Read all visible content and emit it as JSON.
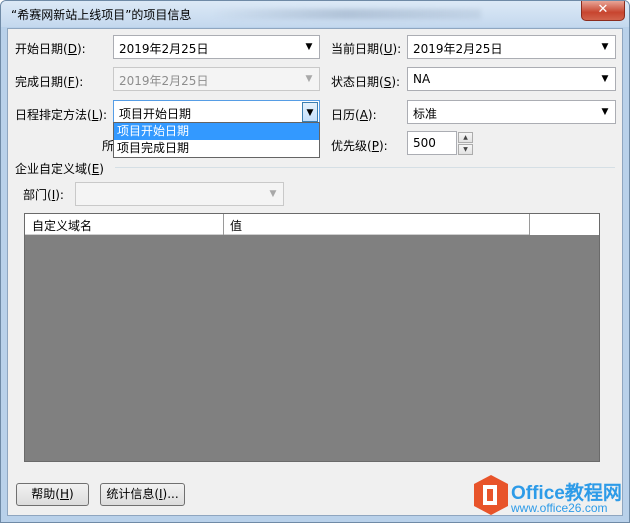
{
  "window": {
    "title": "“希赛网新站上线项目”的项目信息",
    "close_glyph": "✕"
  },
  "fields": {
    "start_date": {
      "label_pre": "开始日期(",
      "key": "D",
      "label_post": "):",
      "value": "2019年2月25日"
    },
    "current_date": {
      "label_pre": "当前日期(",
      "key": "U",
      "label_post": "):",
      "value": "2019年2月25日"
    },
    "finish_date": {
      "label_pre": "完成日期(",
      "key": "F",
      "label_post": "):",
      "value": "2019年2月25日"
    },
    "status_date": {
      "label_pre": "状态日期(",
      "key": "S",
      "label_post": "):",
      "value": "NA"
    },
    "schedule_from": {
      "label_pre": "日程排定方法(",
      "key": "L",
      "label_post": "):",
      "value": "项目开始日期"
    },
    "calendar": {
      "label_pre": "日历(",
      "key": "A",
      "label_post": "):",
      "value": "标准"
    },
    "priority": {
      "label_pre": "优先级(",
      "key": "P",
      "label_post": "):",
      "value": "500"
    },
    "hidden_label_fragment": "所"
  },
  "schedule_options": [
    "项目开始日期",
    "项目完成日期"
  ],
  "enterprise": {
    "group_pre": "企业自定义域(",
    "group_key": "E",
    "group_post": ")",
    "dept_pre": "部门(",
    "dept_key": "I",
    "dept_post": "):",
    "dept_value": "",
    "columns": [
      "自定义域名",
      "值"
    ]
  },
  "buttons": {
    "help": {
      "pre": "帮助(",
      "key": "H",
      "post": ")"
    },
    "stats": {
      "pre": "统计信息(",
      "key": "I",
      "post": ")..."
    }
  },
  "watermark": {
    "brand": "Office教程网",
    "url": "www.office26.com"
  },
  "colors": {
    "accent_selected": "#3399ff",
    "grid_bg": "#808080",
    "logo_orange": "#e8542a"
  }
}
